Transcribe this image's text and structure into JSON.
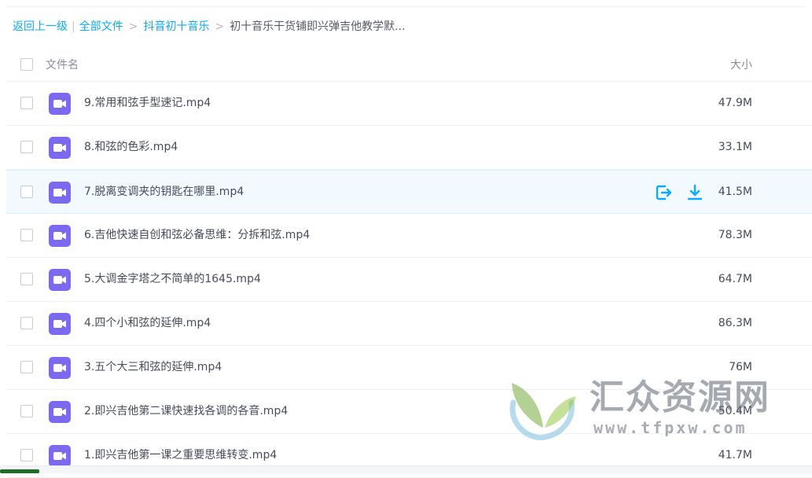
{
  "breadcrumb": {
    "back": "返回上一级",
    "separator_bar": "|",
    "separator": ">",
    "items": [
      "全部文件",
      "抖音初十音乐"
    ],
    "current": "初十音乐干货铺即兴弹吉他教学默..."
  },
  "header": {
    "name_label": "文件名",
    "size_label": "大小"
  },
  "files": [
    {
      "name": "9.常用和弦手型速记.mp4",
      "size": "47.9M",
      "icon": "video-file-icon"
    },
    {
      "name": "8.和弦的色彩.mp4",
      "size": "33.1M",
      "icon": "video-file-icon"
    },
    {
      "name": "7.脱离变调夹的钥匙在哪里.mp4",
      "size": "41.5M",
      "icon": "video-file-icon",
      "hovered": true
    },
    {
      "name": "6.吉他快速自创和弦必备思维：分拆和弦.mp4",
      "size": "78.3M",
      "icon": "video-file-icon"
    },
    {
      "name": "5.大调金字塔之不简单的1645.mp4",
      "size": "64.7M",
      "icon": "video-file-icon"
    },
    {
      "name": "4.四个小和弦的延伸.mp4",
      "size": "86.3M",
      "icon": "video-file-icon"
    },
    {
      "name": "3.五个大三和弦的延伸.mp4",
      "size": "76M",
      "icon": "video-file-icon"
    },
    {
      "name": "2.即兴吉他第二课快速找各调的各音.mp4",
      "size": "50.4M",
      "icon": "video-file-icon"
    },
    {
      "name": "1.即兴吉他第一课之重要思维转变.mp4",
      "size": "41.7M",
      "icon": "video-file-icon"
    }
  ],
  "row_actions": {
    "share_icon": "share-icon",
    "download_icon": "download-icon"
  },
  "watermark": {
    "title": "汇众资源网",
    "url": "www.tfpxw.com"
  },
  "colors": {
    "link": "#09aaff",
    "video_icon": "#7b6af0",
    "action": "#09aaff",
    "hover_row": "#f2faff"
  }
}
